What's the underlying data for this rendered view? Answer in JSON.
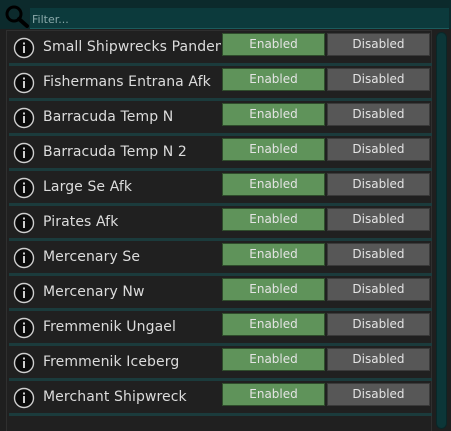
{
  "filter": {
    "placeholder": "Filter..."
  },
  "colors": {
    "enabled_button": "#5f935a",
    "disabled_button": "#575757",
    "filter_bar": "#0c2a2c",
    "scrollbar_thumb": "#0c3638"
  },
  "plugins": [
    {
      "name": "Small Shipwrecks Pandem...",
      "enabled_label": "Enabled",
      "disabled_label": "Disabled",
      "state": "enabled"
    },
    {
      "name": "Fishermans Entrana Afk",
      "enabled_label": "Enabled",
      "disabled_label": "Disabled",
      "state": "enabled"
    },
    {
      "name": "Barracuda Temp N",
      "enabled_label": "Enabled",
      "disabled_label": "Disabled",
      "state": "enabled"
    },
    {
      "name": "Barracuda Temp N 2",
      "enabled_label": "Enabled",
      "disabled_label": "Disabled",
      "state": "enabled"
    },
    {
      "name": "Large Se Afk",
      "enabled_label": "Enabled",
      "disabled_label": "Disabled",
      "state": "enabled"
    },
    {
      "name": "Pirates Afk",
      "enabled_label": "Enabled",
      "disabled_label": "Disabled",
      "state": "enabled"
    },
    {
      "name": "Mercenary Se",
      "enabled_label": "Enabled",
      "disabled_label": "Disabled",
      "state": "enabled"
    },
    {
      "name": "Mercenary Nw",
      "enabled_label": "Enabled",
      "disabled_label": "Disabled",
      "state": "enabled"
    },
    {
      "name": "Fremmenik Ungael",
      "enabled_label": "Enabled",
      "disabled_label": "Disabled",
      "state": "enabled"
    },
    {
      "name": "Fremmenik Iceberg",
      "enabled_label": "Enabled",
      "disabled_label": "Disabled",
      "state": "enabled"
    },
    {
      "name": "Merchant Shipwreck",
      "enabled_label": "Enabled",
      "disabled_label": "Disabled",
      "state": "enabled"
    }
  ]
}
